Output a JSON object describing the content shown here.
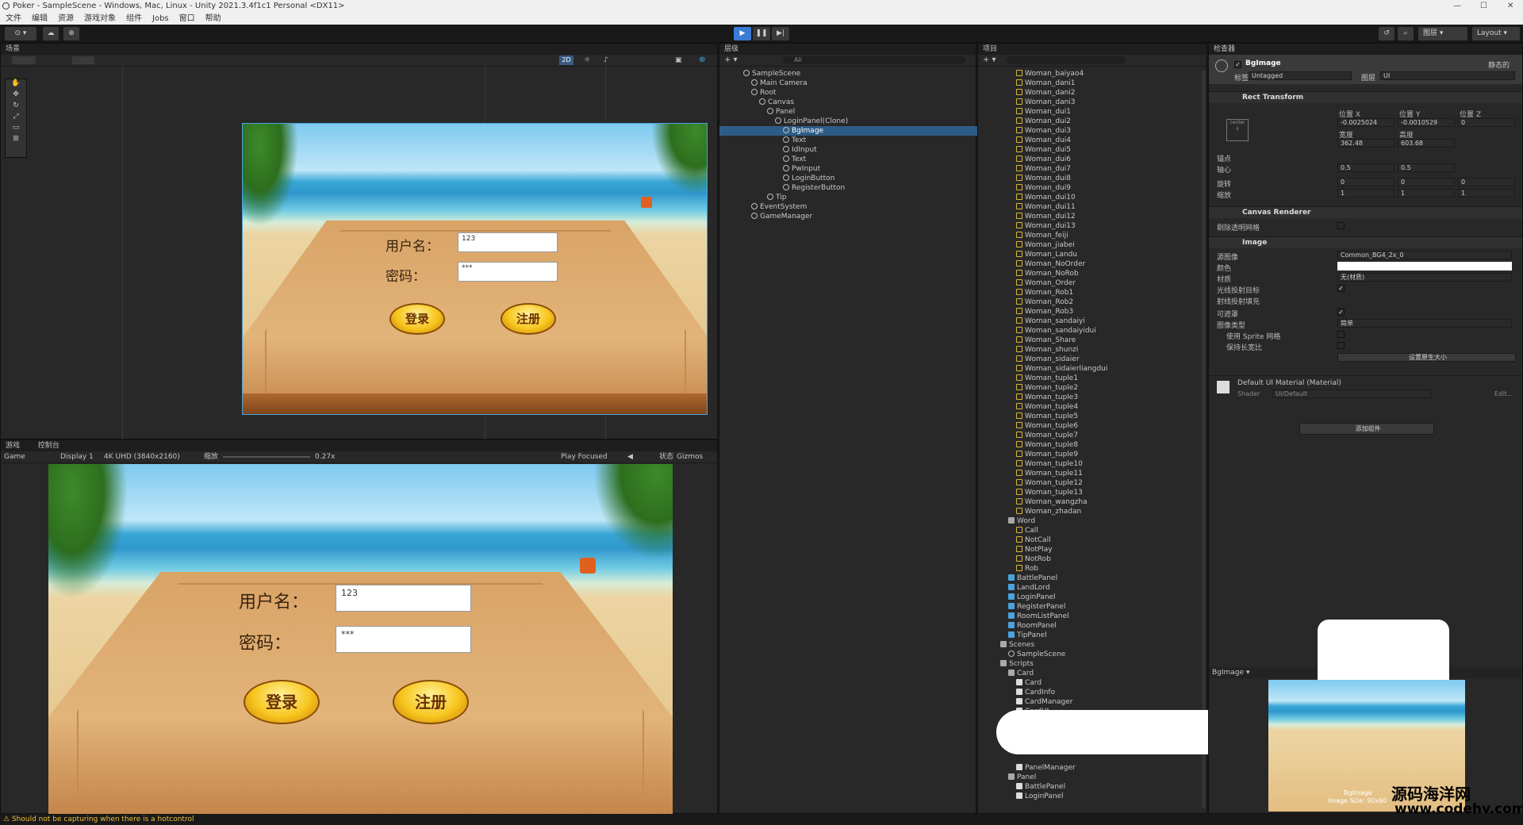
{
  "window": {
    "title": "Poker - SampleScene - Windows, Mac, Linux - Unity 2021.3.4f1c1 Personal <DX11>"
  },
  "menu": [
    "文件",
    "编辑",
    "资源",
    "游戏对象",
    "组件",
    "Jobs",
    "窗口",
    "帮助"
  ],
  "toolbar": {
    "play": "▶",
    "pause": "❚❚",
    "step": "▶|",
    "layers": "图层",
    "layout": "Layout"
  },
  "scene_panel": {
    "tab": "场景",
    "mode_2d": "2D"
  },
  "login": {
    "username_label": "用户名：",
    "username_value": "123",
    "password_label": "密码：",
    "password_value": "***",
    "login_button": "登录",
    "register_button": "注册"
  },
  "game_panel": {
    "tab_game": "游戏",
    "tab_console": "控制台",
    "game_label": "Game",
    "display": "Display 1",
    "resolution": "4K UHD (3840x2160)",
    "scale_label": "缩放",
    "scale_value": "0.27x",
    "play_focused": "Play Focused",
    "stats": "状态",
    "gizmos": "Gizmos"
  },
  "hierarchy": {
    "tab": "层级",
    "search_placeholder": "All",
    "items": [
      {
        "label": "SampleScene",
        "depth": 0,
        "icon": "scene"
      },
      {
        "label": "Main Camera",
        "depth": 1,
        "icon": "go"
      },
      {
        "label": "Root",
        "depth": 1,
        "icon": "go"
      },
      {
        "label": "Canvas",
        "depth": 2,
        "icon": "go"
      },
      {
        "label": "Panel",
        "depth": 3,
        "icon": "go"
      },
      {
        "label": "LoginPanel(Clone)",
        "depth": 4,
        "icon": "go"
      },
      {
        "label": "BgImage",
        "depth": 5,
        "icon": "go",
        "selected": true
      },
      {
        "label": "Text",
        "depth": 5,
        "icon": "go"
      },
      {
        "label": "IdInput",
        "depth": 5,
        "icon": "go"
      },
      {
        "label": "Text",
        "depth": 5,
        "icon": "go"
      },
      {
        "label": "PwInput",
        "depth": 5,
        "icon": "go"
      },
      {
        "label": "LoginButton",
        "depth": 5,
        "icon": "go"
      },
      {
        "label": "RegisterButton",
        "depth": 5,
        "icon": "go"
      },
      {
        "label": "Tip",
        "depth": 3,
        "icon": "go"
      },
      {
        "label": "EventSystem",
        "depth": 1,
        "icon": "go"
      },
      {
        "label": "GameManager",
        "depth": 1,
        "icon": "go"
      }
    ]
  },
  "project": {
    "tab": "项目",
    "items": [
      {
        "label": "Woman_baiyao4",
        "depth": 3,
        "icon": "anim"
      },
      {
        "label": "Woman_dani1",
        "depth": 3,
        "icon": "anim"
      },
      {
        "label": "Woman_dani2",
        "depth": 3,
        "icon": "anim"
      },
      {
        "label": "Woman_dani3",
        "depth": 3,
        "icon": "anim"
      },
      {
        "label": "Woman_dui1",
        "depth": 3,
        "icon": "anim"
      },
      {
        "label": "Woman_dui2",
        "depth": 3,
        "icon": "anim"
      },
      {
        "label": "Woman_dui3",
        "depth": 3,
        "icon": "anim"
      },
      {
        "label": "Woman_dui4",
        "depth": 3,
        "icon": "anim"
      },
      {
        "label": "Woman_dui5",
        "depth": 3,
        "icon": "anim"
      },
      {
        "label": "Woman_dui6",
        "depth": 3,
        "icon": "anim"
      },
      {
        "label": "Woman_dui7",
        "depth": 3,
        "icon": "anim"
      },
      {
        "label": "Woman_dui8",
        "depth": 3,
        "icon": "anim"
      },
      {
        "label": "Woman_dui9",
        "depth": 3,
        "icon": "anim"
      },
      {
        "label": "Woman_dui10",
        "depth": 3,
        "icon": "anim"
      },
      {
        "label": "Woman_dui11",
        "depth": 3,
        "icon": "anim"
      },
      {
        "label": "Woman_dui12",
        "depth": 3,
        "icon": "anim"
      },
      {
        "label": "Woman_dui13",
        "depth": 3,
        "icon": "anim"
      },
      {
        "label": "Woman_feiji",
        "depth": 3,
        "icon": "anim"
      },
      {
        "label": "Woman_jiabei",
        "depth": 3,
        "icon": "anim"
      },
      {
        "label": "Woman_Landu",
        "depth": 3,
        "icon": "anim"
      },
      {
        "label": "Woman_NoOrder",
        "depth": 3,
        "icon": "anim"
      },
      {
        "label": "Woman_NoRob",
        "depth": 3,
        "icon": "anim"
      },
      {
        "label": "Woman_Order",
        "depth": 3,
        "icon": "anim"
      },
      {
        "label": "Woman_Rob1",
        "depth": 3,
        "icon": "anim"
      },
      {
        "label": "Woman_Rob2",
        "depth": 3,
        "icon": "anim"
      },
      {
        "label": "Woman_Rob3",
        "depth": 3,
        "icon": "anim"
      },
      {
        "label": "Woman_sandaiyi",
        "depth": 3,
        "icon": "anim"
      },
      {
        "label": "Woman_sandaiyidui",
        "depth": 3,
        "icon": "anim"
      },
      {
        "label": "Woman_Share",
        "depth": 3,
        "icon": "anim"
      },
      {
        "label": "Woman_shunzi",
        "depth": 3,
        "icon": "anim"
      },
      {
        "label": "Woman_sidaier",
        "depth": 3,
        "icon": "anim"
      },
      {
        "label": "Woman_sidaierliangdui",
        "depth": 3,
        "icon": "anim"
      },
      {
        "label": "Woman_tuple1",
        "depth": 3,
        "icon": "anim"
      },
      {
        "label": "Woman_tuple2",
        "depth": 3,
        "icon": "anim"
      },
      {
        "label": "Woman_tuple3",
        "depth": 3,
        "icon": "anim"
      },
      {
        "label": "Woman_tuple4",
        "depth": 3,
        "icon": "anim"
      },
      {
        "label": "Woman_tuple5",
        "depth": 3,
        "icon": "anim"
      },
      {
        "label": "Woman_tuple6",
        "depth": 3,
        "icon": "anim"
      },
      {
        "label": "Woman_tuple7",
        "depth": 3,
        "icon": "anim"
      },
      {
        "label": "Woman_tuple8",
        "depth": 3,
        "icon": "anim"
      },
      {
        "label": "Woman_tuple9",
        "depth": 3,
        "icon": "anim"
      },
      {
        "label": "Woman_tuple10",
        "depth": 3,
        "icon": "anim"
      },
      {
        "label": "Woman_tuple11",
        "depth": 3,
        "icon": "anim"
      },
      {
        "label": "Woman_tuple12",
        "depth": 3,
        "icon": "anim"
      },
      {
        "label": "Woman_tuple13",
        "depth": 3,
        "icon": "anim"
      },
      {
        "label": "Woman_wangzha",
        "depth": 3,
        "icon": "anim"
      },
      {
        "label": "Woman_zhadan",
        "depth": 3,
        "icon": "anim"
      },
      {
        "label": "Word",
        "depth": 2,
        "icon": "folder"
      },
      {
        "label": "Call",
        "depth": 3,
        "icon": "anim"
      },
      {
        "label": "NotCall",
        "depth": 3,
        "icon": "anim"
      },
      {
        "label": "NotPlay",
        "depth": 3,
        "icon": "anim"
      },
      {
        "label": "NotRob",
        "depth": 3,
        "icon": "anim"
      },
      {
        "label": "Rob",
        "depth": 3,
        "icon": "anim"
      },
      {
        "label": "BattlePanel",
        "depth": 2,
        "icon": "prefab"
      },
      {
        "label": "LandLord",
        "depth": 2,
        "icon": "prefab"
      },
      {
        "label": "LoginPanel",
        "depth": 2,
        "icon": "prefab"
      },
      {
        "label": "RegisterPanel",
        "depth": 2,
        "icon": "prefab"
      },
      {
        "label": "RoomListPanel",
        "depth": 2,
        "icon": "prefab"
      },
      {
        "label": "RoomPanel",
        "depth": 2,
        "icon": "prefab"
      },
      {
        "label": "TipPanel",
        "depth": 2,
        "icon": "prefab"
      },
      {
        "label": "Scenes",
        "depth": 1,
        "icon": "folder"
      },
      {
        "label": "SampleScene",
        "depth": 2,
        "icon": "scene"
      },
      {
        "label": "Scripts",
        "depth": 1,
        "icon": "folder"
      },
      {
        "label": "Card",
        "depth": 2,
        "icon": "folder"
      },
      {
        "label": "Card",
        "depth": 3,
        "icon": "cs"
      },
      {
        "label": "CardInfo",
        "depth": 3,
        "icon": "cs"
      },
      {
        "label": "CardManager",
        "depth": 3,
        "icon": "cs"
      },
      {
        "label": "CardUI",
        "depth": 3,
        "icon": "cs"
      }
    ],
    "items_bottom": [
      {
        "label": "PanelManager",
        "depth": 3,
        "icon": "cs"
      },
      {
        "label": "Panel",
        "depth": 2,
        "icon": "folder"
      },
      {
        "label": "BattlePanel",
        "depth": 3,
        "icon": "cs"
      },
      {
        "label": "LoginPanel",
        "depth": 3,
        "icon": "cs"
      }
    ]
  },
  "inspector": {
    "tab": "检查器",
    "object_name": "BgImage",
    "static_label": "静态的",
    "tag_label": "标签",
    "tag_value": "Untagged",
    "layer_label": "图层",
    "layer_value": "UI",
    "rect_transform": {
      "title": "Rect Transform",
      "anchor": "center",
      "pos_x_label": "位置 X",
      "pos_y_label": "位置 Y",
      "pos_z_label": "位置 Z",
      "pos_x": "-0.0025024",
      "pos_y": "-0.0010529",
      "pos_z": "0",
      "width_label": "宽度",
      "height_label": "高度",
      "width": "362.48",
      "height": "603.68",
      "anchors_label": "锚点",
      "pivot_label": "轴心",
      "pivot_x": "0.5",
      "pivot_y": "0.5",
      "rotation_label": "旋转",
      "rot_x": "0",
      "rot_y": "0",
      "rot_z": "0",
      "scale_label": "缩放",
      "scale_x": "1",
      "scale_y": "1",
      "scale_z": "1"
    },
    "canvas_renderer": {
      "title": "Canvas Renderer",
      "cull_label": "剔除透明网格"
    },
    "image": {
      "title": "Image",
      "source_label": "源图像",
      "source_value": "Common_BG4_2x_0",
      "color_label": "颜色",
      "material_label": "材质",
      "material_value": "无(材质)",
      "raycast_label": "光线投射目标",
      "raycast_padding_label": "射线投射填充",
      "maskable_label": "可遮罩",
      "image_type_label": "图像类型",
      "image_type_value": "简单",
      "use_sprite_mesh_label": "使用 Sprite 网格",
      "preserve_aspect_label": "保持长宽比",
      "native_size_button": "设置原生大小"
    },
    "material": {
      "title": "Default UI Material (Material)",
      "shader_label": "Shader",
      "shader_value": "UI/Default",
      "edit_label": "Edit..."
    },
    "add_component": "添加组件",
    "preview": {
      "title": "BgImage",
      "caption": "BgImage",
      "size": "Image Size: 90x60"
    }
  },
  "console": {
    "message": "Should not be capturing when there is a hotcontrol"
  },
  "watermark": {
    "cn": "源码海洋网",
    "url": "www.codehy.com"
  },
  "colors": {
    "accent": "#2c5d87",
    "play_active": "#3a7bd5",
    "selection": "#2c5d87",
    "warning": "#f0c040"
  }
}
